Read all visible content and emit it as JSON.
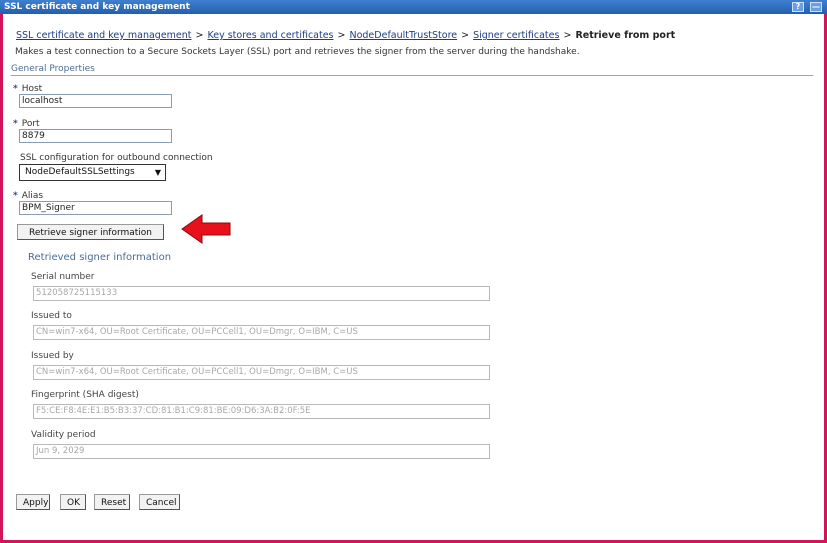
{
  "window": {
    "title": "SSL certificate and key management",
    "help_button": "?",
    "minimize_button": "—"
  },
  "breadcrumb": {
    "items": [
      "SSL certificate and key management",
      "Key stores and certificates",
      "NodeDefaultTrustStore",
      "Signer certificates"
    ],
    "separator": ">",
    "current": "Retrieve from port"
  },
  "description": "Makes a test connection to a Secure Sockets Layer (SSL) port and retrieves the signer from the server during the handshake.",
  "general_properties": {
    "title": "General Properties",
    "required_marker": "*",
    "host": {
      "label": "Host",
      "value": "localhost"
    },
    "port": {
      "label": "Port",
      "value": "8879"
    },
    "ssl_config": {
      "label": "SSL configuration for outbound connection",
      "selected": "NodeDefaultSSLSettings"
    },
    "alias": {
      "label": "Alias",
      "value": "BPM_Signer"
    },
    "retrieve_button": "Retrieve signer information",
    "arrow_color": "#e8101a"
  },
  "retrieved": {
    "title": "Retrieved signer information",
    "fields": [
      {
        "label": "Serial number",
        "value": "512058725115133"
      },
      {
        "label": "Issued to",
        "value": "CN=win7-x64, OU=Root Certificate, OU=PCCell1, OU=Dmgr, O=IBM, C=US"
      },
      {
        "label": "Issued by",
        "value": "CN=win7-x64, OU=Root Certificate, OU=PCCell1, OU=Dmgr, O=IBM, C=US"
      },
      {
        "label": "Fingerprint (SHA digest)",
        "value": "F5:CE:F8:4E:E1:B5:B3:37:CD:81:B1:C9:81:BE:09:D6:3A:B2:0F:5E"
      },
      {
        "label": "Validity period",
        "value": "Jun 9, 2029"
      }
    ]
  },
  "actions": {
    "apply": "Apply",
    "ok": "OK",
    "reset": "Reset",
    "cancel": "Cancel"
  }
}
